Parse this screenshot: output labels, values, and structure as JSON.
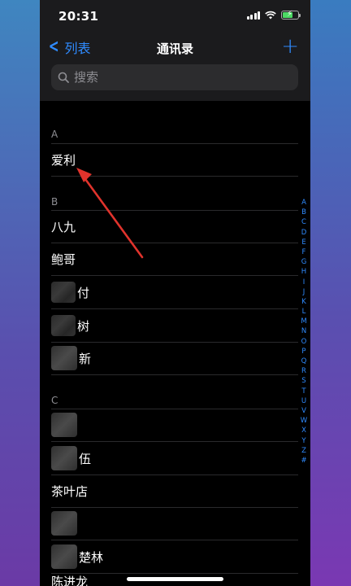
{
  "status_bar": {
    "time": "20:31"
  },
  "navbar": {
    "back_label": "列表",
    "title": "通讯录",
    "add_label": "+"
  },
  "search": {
    "placeholder": "搜索"
  },
  "sections": [
    {
      "letter": "A",
      "contacts": [
        "爱利"
      ]
    },
    {
      "letter": "B",
      "contacts": [
        "八九",
        "鲍哥",
        "付",
        "树",
        "新"
      ]
    },
    {
      "letter": "C",
      "contacts": [
        "",
        "伍",
        "茶叶店",
        "",
        "楚林",
        "陈进龙"
      ]
    }
  ],
  "index_letters": [
    "A",
    "B",
    "C",
    "D",
    "E",
    "F",
    "G",
    "H",
    "I",
    "J",
    "K",
    "L",
    "M",
    "N",
    "O",
    "P",
    "Q",
    "R",
    "S",
    "T",
    "U",
    "V",
    "W",
    "X",
    "Y",
    "Z",
    "#"
  ],
  "colors": {
    "accent": "#2f8bff",
    "annotation_arrow": "#e0332c"
  }
}
